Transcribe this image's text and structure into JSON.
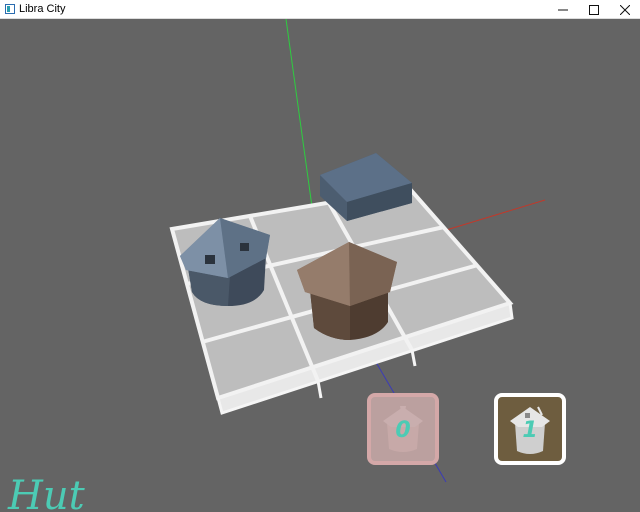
{
  "window": {
    "title": "Libra City",
    "icon": "app-icon",
    "controls": [
      "minimize-icon",
      "maximize-icon",
      "close-icon"
    ]
  },
  "scene": {
    "grid": "3x3 tile board",
    "objects": [
      "blue-gray-hut",
      "brown-hut",
      "blue-gray-block"
    ],
    "axes_colors": {
      "x": "#c0392b",
      "y": "#2ecc40",
      "z": "#3b3bb8"
    }
  },
  "hotbar": {
    "slots": [
      {
        "icon": "hut-icon",
        "count": "0",
        "selected": false
      },
      {
        "icon": "hut-icon",
        "count": "1",
        "selected": true
      }
    ]
  },
  "selected_item_label": "Hut",
  "colors": {
    "background": "#646464",
    "accent_text": "#4ccbb4",
    "slot_selected_border": "#ffffff",
    "slot_unselected_border": "#d4a8a8"
  }
}
